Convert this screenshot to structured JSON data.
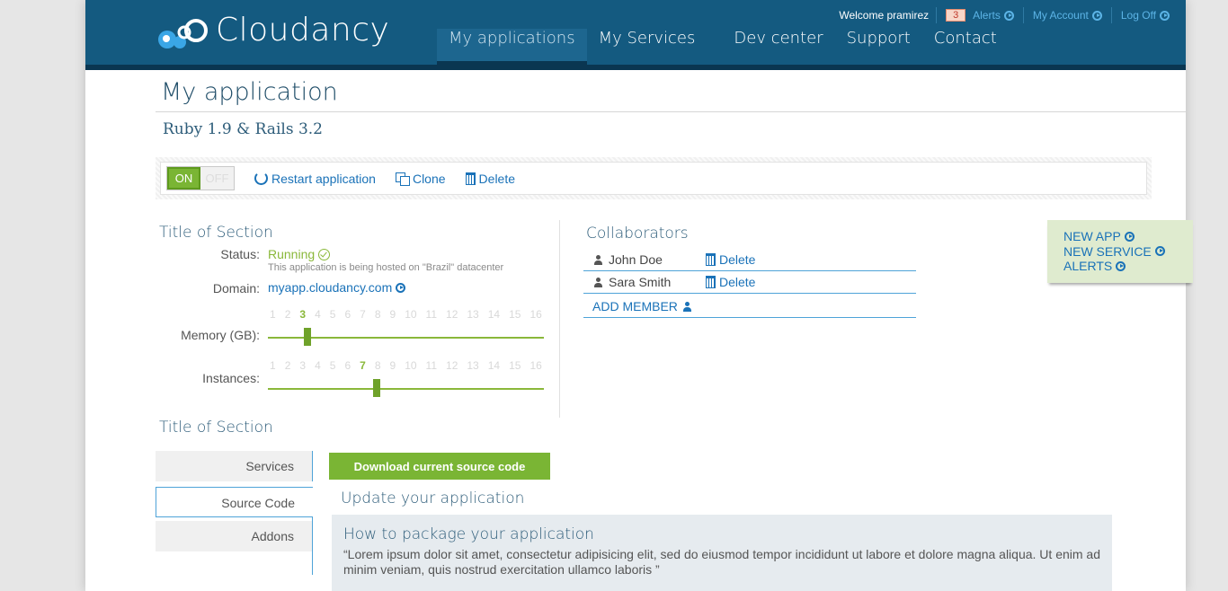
{
  "brand": {
    "name": "Cloudancy"
  },
  "topbar": {
    "welcome": "Welcome pramirez",
    "alerts_count": "3",
    "alerts_label": "Alerts",
    "account_label": "My Account",
    "logoff_label": "Log Off"
  },
  "nav": [
    {
      "label": "My applications",
      "active": true
    },
    {
      "label": "My Services"
    },
    {
      "label": "Dev center"
    },
    {
      "label": "Support"
    },
    {
      "label": "Contact"
    }
  ],
  "page": {
    "title": "My application",
    "subtitle": "Ruby 1.9 & Rails 3.2"
  },
  "toolbar": {
    "on_label": "ON",
    "off_label": "OFF",
    "restart_label": "Restart application",
    "clone_label": "Clone",
    "delete_label": "Delete"
  },
  "details": {
    "section_title": "Title of Section",
    "status_label": "Status:",
    "status_value": "Running",
    "status_note": "This application is being hosted on \"Brazil\" datacenter",
    "domain_label": "Domain:",
    "domain_value": "myapp.cloudancy.com",
    "memory_label": "Memory (GB):",
    "memory_ticks": [
      "1",
      "2",
      "3",
      "4",
      "5",
      "6",
      "7",
      "8",
      "9",
      "10",
      "11",
      "12",
      "13",
      "14",
      "15",
      "16"
    ],
    "memory_value": 3,
    "instances_label": "Instances:",
    "instances_ticks": [
      "1",
      "2",
      "3",
      "4",
      "5",
      "6",
      "7",
      "8",
      "9",
      "10",
      "11",
      "12",
      "13",
      "14",
      "15",
      "16"
    ],
    "instances_value": 7
  },
  "collaborators": {
    "title": "Collaborators",
    "members": [
      {
        "name": "John Doe",
        "action": "Delete"
      },
      {
        "name": "Sara Smith",
        "action": "Delete"
      }
    ],
    "add_label": "ADD MEMBER"
  },
  "side_widget": {
    "new_app": "NEW APP",
    "new_service": "NEW SERVICE",
    "alerts": "ALERTS"
  },
  "source": {
    "section_title": "Title of Section",
    "tabs": [
      "Services",
      "Source Code",
      "Addons"
    ],
    "active_tab": 1,
    "download_label": "Download current source code",
    "update_title": "Update your application",
    "how_title": "How to package your application",
    "how_text": "“Lorem ipsum dolor sit amet, consectetur adipisicing elit, sed do eiusmod tempor incididunt ut labore et dolore magna aliqua. Ut enim ad minim veniam, quis nostrud exercitation ullamco laboris ”"
  },
  "colors": {
    "header": "#145a80",
    "accent_green": "#7ab534",
    "link_blue": "#1a72b8"
  }
}
